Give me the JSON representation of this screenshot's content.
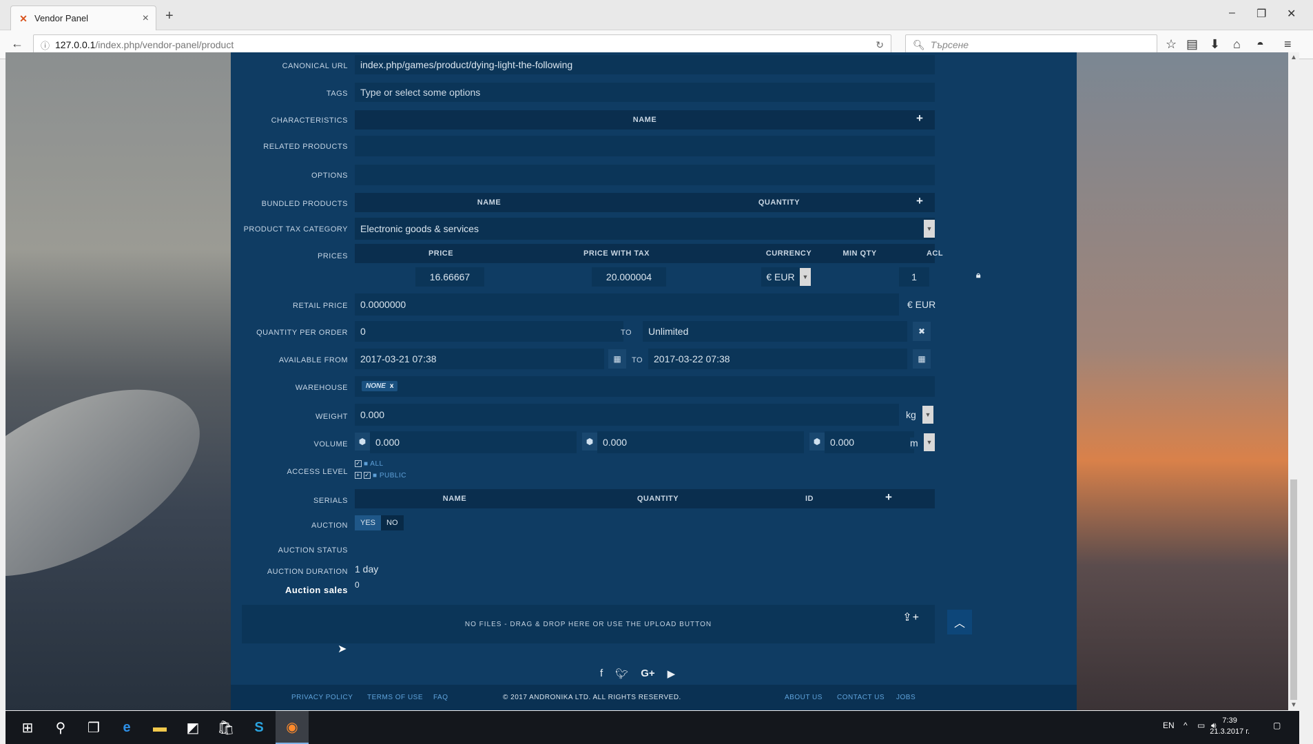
{
  "browser": {
    "tab_title": "Vendor Panel",
    "url_host": "127.0.0.1",
    "url_path": "/index.php/vendor-panel/product",
    "search_placeholder": "Търсене"
  },
  "form": {
    "canonical_url": {
      "label": "CANONICAL URL",
      "value": "index.php/games/product/dying-light-the-following"
    },
    "tags": {
      "label": "TAGS",
      "placeholder": "Type or select some options"
    },
    "characteristics": {
      "label": "CHARACTERISTICS",
      "col_name": "NAME"
    },
    "related_products": {
      "label": "RELATED PRODUCTS"
    },
    "options": {
      "label": "OPTIONS"
    },
    "bundled_products": {
      "label": "BUNDLED PRODUCTS",
      "col_name": "NAME",
      "col_quantity": "QUANTITY"
    },
    "tax_category": {
      "label": "PRODUCT TAX CATEGORY",
      "value": "Electronic goods & services"
    },
    "prices": {
      "label": "PRICES",
      "headers": [
        "PRICE",
        "PRICE WITH TAX",
        "CURRENCY",
        "MIN QTY",
        "ACL"
      ],
      "row": {
        "price": "16.66667",
        "price_with_tax": "20.000004",
        "currency": "€ EUR",
        "min_qty": "1"
      }
    },
    "retail_price": {
      "label": "RETAIL PRICE",
      "value": "0.0000000",
      "currency": "€ EUR"
    },
    "quantity_per_order": {
      "label": "QUANTITY PER ORDER",
      "from": "0",
      "to_label": "TO",
      "to": "Unlimited"
    },
    "available_from": {
      "label": "AVAILABLE FROM",
      "from": "2017-03-21 07:38",
      "to_label": "TO",
      "to": "2017-03-22 07:38"
    },
    "warehouse": {
      "label": "WAREHOUSE",
      "tag": "NONE"
    },
    "weight": {
      "label": "WEIGHT",
      "value": "0.000",
      "unit": "kg"
    },
    "volume": {
      "label": "VOLUME",
      "x": "0.000",
      "y": "0.000",
      "z": "0.000",
      "unit": "m"
    },
    "access_level": {
      "label": "ACCESS LEVEL",
      "items": [
        "ALL",
        "PUBLIC"
      ]
    },
    "serials": {
      "label": "SERIALS",
      "headers": [
        "NAME",
        "QUANTITY",
        "ID"
      ]
    },
    "auction": {
      "label": "AUCTION",
      "yes": "YES",
      "no": "NO"
    },
    "auction_status": {
      "label": "AUCTION STATUS"
    },
    "auction_duration": {
      "label": "AUCTION DURATION",
      "value": "1 day"
    },
    "auction_sales": {
      "label": "Auction sales",
      "value": "0"
    },
    "upload_text": "NO FILES - DRAG & DROP HERE OR USE THE UPLOAD BUTTON"
  },
  "footer": {
    "links_left": [
      "PRIVACY POLICY",
      "TERMS OF USE",
      "FAQ"
    ],
    "copyright": "© 2017 ANDRONIKA LTD. ALL RIGHTS RESERVED.",
    "links_right": [
      "ABOUT US",
      "CONTACT US",
      "JOBS"
    ]
  },
  "taskbar": {
    "lang": "EN",
    "time": "7:39",
    "date": "21.3.2017 г."
  },
  "colors": {
    "panel": "#0f3c63",
    "field": "#0b3558",
    "header": "#0a2e4e",
    "link": "#5fa3db"
  }
}
